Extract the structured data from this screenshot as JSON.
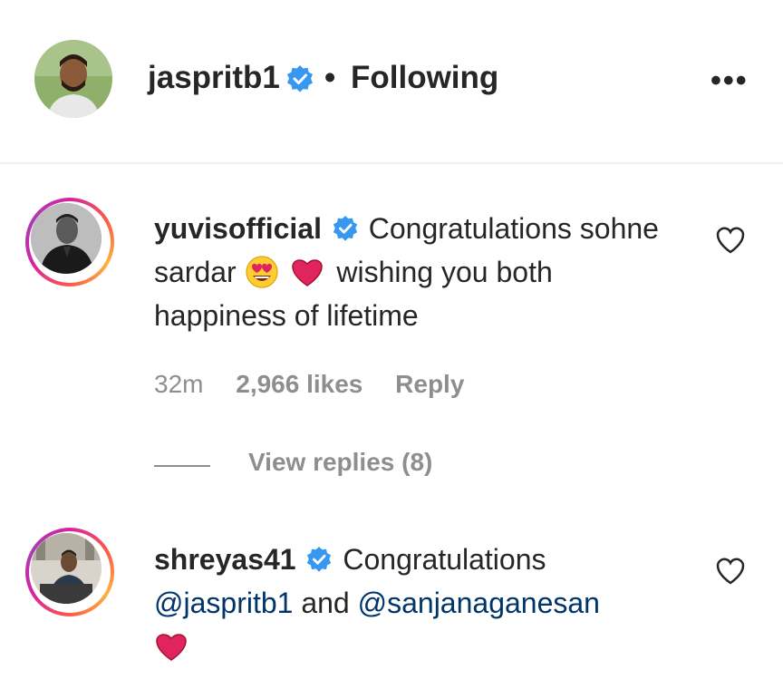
{
  "post_header": {
    "username": "jaspritb1",
    "separator": "•",
    "follow_status": "Following",
    "more_label": "•••"
  },
  "comments": [
    {
      "username": "yuvisofficial",
      "text_part1": "Congratulations sohne sardar",
      "text_part2": "wishing you both happiness of lifetime",
      "time": "32m",
      "likes": "2,966 likes",
      "reply_label": "Reply",
      "view_replies": "View replies (8)"
    },
    {
      "username": "shreyas41",
      "text_part1": "Congratulations",
      "mention1": "@jaspritb1",
      "and_word": "and",
      "mention2": "@sanjanaganesan"
    }
  ],
  "colors": {
    "verified": "#3897f0",
    "mention": "#003569",
    "secondary_text": "#8e8e8e",
    "heart": "#e0245e"
  }
}
